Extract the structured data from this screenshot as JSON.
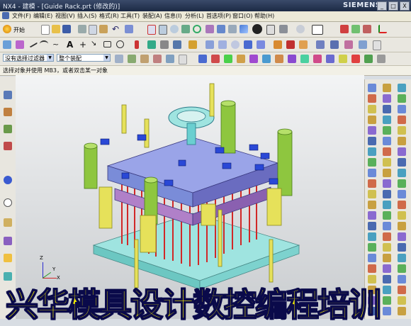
{
  "title_bar": {
    "title": "NX4 - 建模 - [Guide Rack.prt  (修改的)]",
    "brand": "SIEMENS",
    "buttons": [
      "_",
      "□",
      "X"
    ]
  },
  "menu": {
    "items": [
      "文件(F)",
      "编辑(E)",
      "视图(V)",
      "插入(S)",
      "格式(R)",
      "工具(T)",
      "装配(A)",
      "信息(I)",
      "分析(L)",
      "首选项(P)",
      "窗口(O)",
      "帮助(H)"
    ]
  },
  "toolbar": {
    "start_label": "开始",
    "filter_selector": "没有选择过滤器",
    "assembly_selector": "整个装配"
  },
  "status": {
    "prompt": "选择对象并使用 MB3，或者双击某一对象"
  },
  "banner": {
    "text": "兴华模具设计数控编程培训"
  },
  "viewport": {
    "axis_labels": [
      "X",
      "Y",
      "Z"
    ]
  },
  "colors": {
    "plate_blue": "#7a8cd8",
    "plate_cyan": "#9fe4e0",
    "pin_green": "#8ec63f",
    "pin_yellow": "#e6e15a",
    "ejector_red": "#d12828",
    "screw_blue": "#2a48d6",
    "banner_yellow": "#f4ee00"
  }
}
